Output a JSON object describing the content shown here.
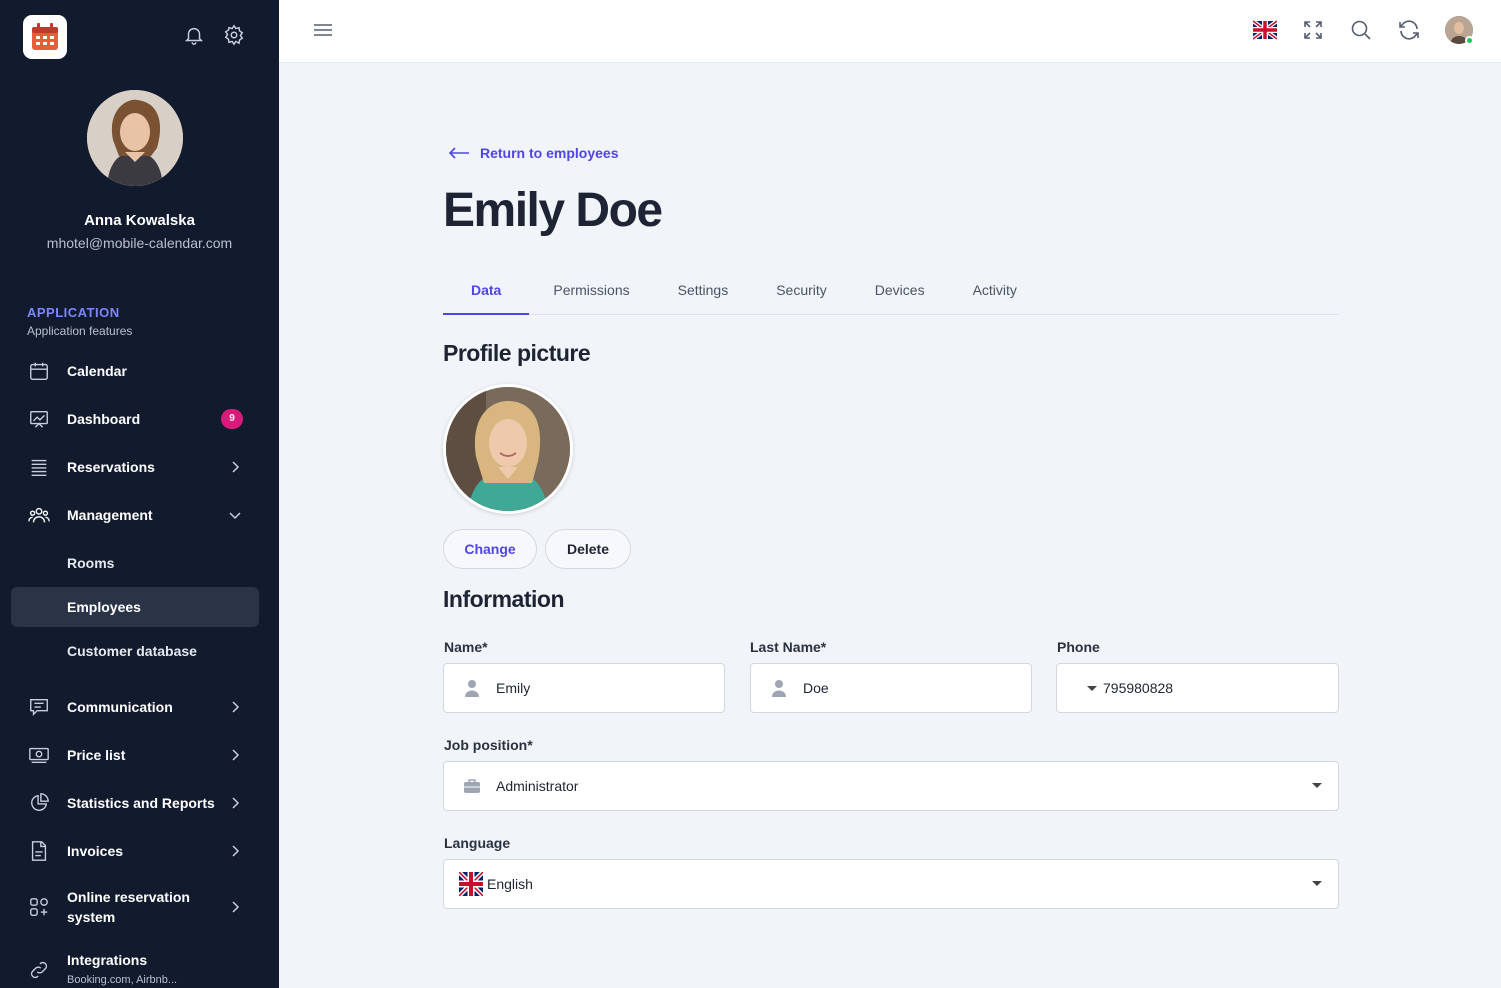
{
  "sidebar": {
    "user_name": "Anna Kowalska",
    "user_email": "mhotel@mobile-calendar.com",
    "section_title": "APPLICATION",
    "section_subtitle": "Application features",
    "items": [
      {
        "label": "Calendar",
        "icon": "calendar-icon"
      },
      {
        "label": "Dashboard",
        "icon": "dashboard-icon",
        "badge": "9"
      },
      {
        "label": "Reservations",
        "icon": "list-icon"
      },
      {
        "label": "Management",
        "icon": "people-icon",
        "expanded": true
      },
      {
        "label": "Communication",
        "icon": "chat-icon"
      },
      {
        "label": "Price list",
        "icon": "money-icon"
      },
      {
        "label": "Statistics and Reports",
        "icon": "pie-chart-icon"
      },
      {
        "label": "Invoices",
        "icon": "document-icon"
      },
      {
        "label": "Online reservation system",
        "label_line1": "Online reservation",
        "label_line2": "system",
        "icon": "apps-icon"
      },
      {
        "label": "Integrations",
        "sublabel": "Booking.com, Airbnb...",
        "icon": "link-icon"
      }
    ],
    "management_sub": [
      {
        "label": "Rooms"
      },
      {
        "label": "Employees",
        "active": true
      },
      {
        "label": "Customer database"
      }
    ]
  },
  "main": {
    "back_link": "Return to employees",
    "title": "Emily Doe",
    "tabs": [
      {
        "label": "Data",
        "active": true
      },
      {
        "label": "Permissions"
      },
      {
        "label": "Settings"
      },
      {
        "label": "Security"
      },
      {
        "label": "Devices"
      },
      {
        "label": "Activity"
      }
    ],
    "profile_heading": "Profile picture",
    "change_label": "Change",
    "delete_label": "Delete",
    "info_heading": "Information",
    "fields": {
      "name_label": "Name*",
      "name_value": "Emily",
      "last_name_label": "Last Name*",
      "last_name_value": "Doe",
      "phone_label": "Phone",
      "phone_value": "795980828",
      "job_label": "Job position*",
      "job_value": "Administrator",
      "language_label": "Language",
      "language_value": "English"
    }
  },
  "colors": {
    "sidebar_bg": "#121a2e",
    "accent": "#4f46e5",
    "badge": "#d81b7a",
    "page_bg": "#f1f4f9"
  }
}
